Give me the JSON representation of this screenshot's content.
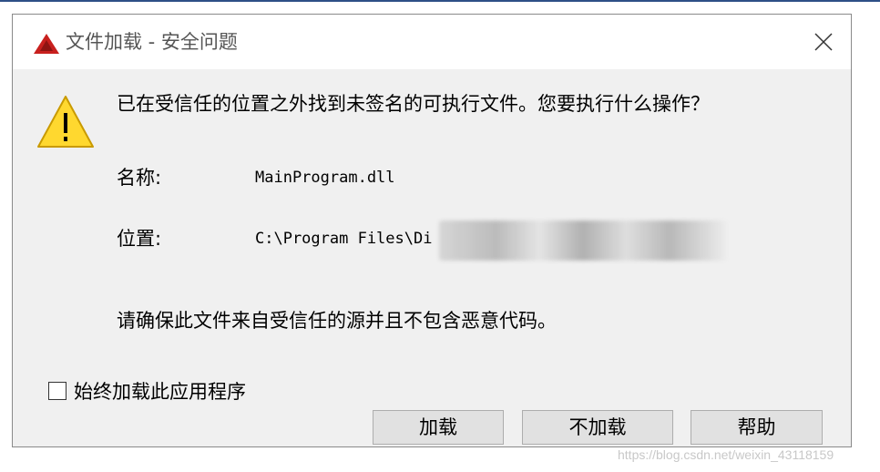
{
  "window": {
    "title": "文件加载 - 安全问题",
    "app_icon": "autocad-logo-icon",
    "close_icon": "close-icon",
    "accent_color": "#c8201e"
  },
  "message": {
    "icon": "warning-icon",
    "text": "已在受信任的位置之外找到未签名的可执行文件。您要执行什么操作？"
  },
  "details": {
    "name_label": "名称:",
    "name_value": "MainProgram.dll",
    "location_label": "位置:",
    "location_value": "C:\\Program Files\\Di"
  },
  "note": "请确保此文件来自受信任的源并且不包含恶意代码。",
  "checkbox": {
    "label": "始终加载此应用程序",
    "checked": false
  },
  "buttons": {
    "load": "加载",
    "dont_load": "不加载",
    "help": "帮助"
  },
  "watermark": "https://blog.csdn.net/weixin_43118159"
}
